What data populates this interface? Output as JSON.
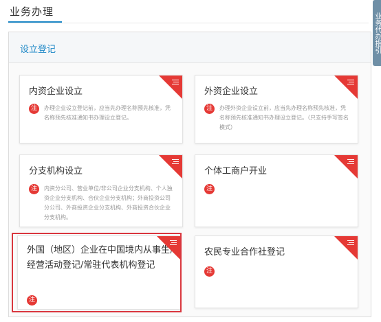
{
  "header": {
    "title": "业务办理"
  },
  "side_tab": {
    "label": "业务代办指引"
  },
  "panel": {
    "title": "设立登记"
  },
  "cards": [
    {
      "title": "内资企业设立",
      "badge": "注",
      "description": "办理企业设立登记前，应当先办理名称预先核准，凭名称预先核准通知书办理设立登记。"
    },
    {
      "title": "外资企业设立",
      "badge": "注",
      "description": "办理外资企业设立前，应当先办理名称预先核准，凭名称预先核准通知书办理设立登记。（只支持手写签名模式）"
    },
    {
      "title": "分支机构设立",
      "badge": "注",
      "description": "内资分公司、营业单位/非公司企业分支机构、个人独资企业分支机构、合伙企业分支机构；外商投资公司分公司、外商投资企业分支机构、外商投资合伙企业分支机构。"
    },
    {
      "title": "个体工商户开业",
      "badge": "注",
      "description": ""
    },
    {
      "title": "外国（地区）企业在中国境内从事生产经营活动登记/常驻代表机构登记",
      "badge": "注",
      "description": ""
    },
    {
      "title": "农民专业合作社登记",
      "badge": "注",
      "description": ""
    }
  ],
  "colors": {
    "accent": "#1e88c7",
    "corner": "#e53935",
    "highlight": "#d9363e"
  },
  "icons": {
    "corner": "menu-lines-icon",
    "badge": "note-badge-icon"
  }
}
